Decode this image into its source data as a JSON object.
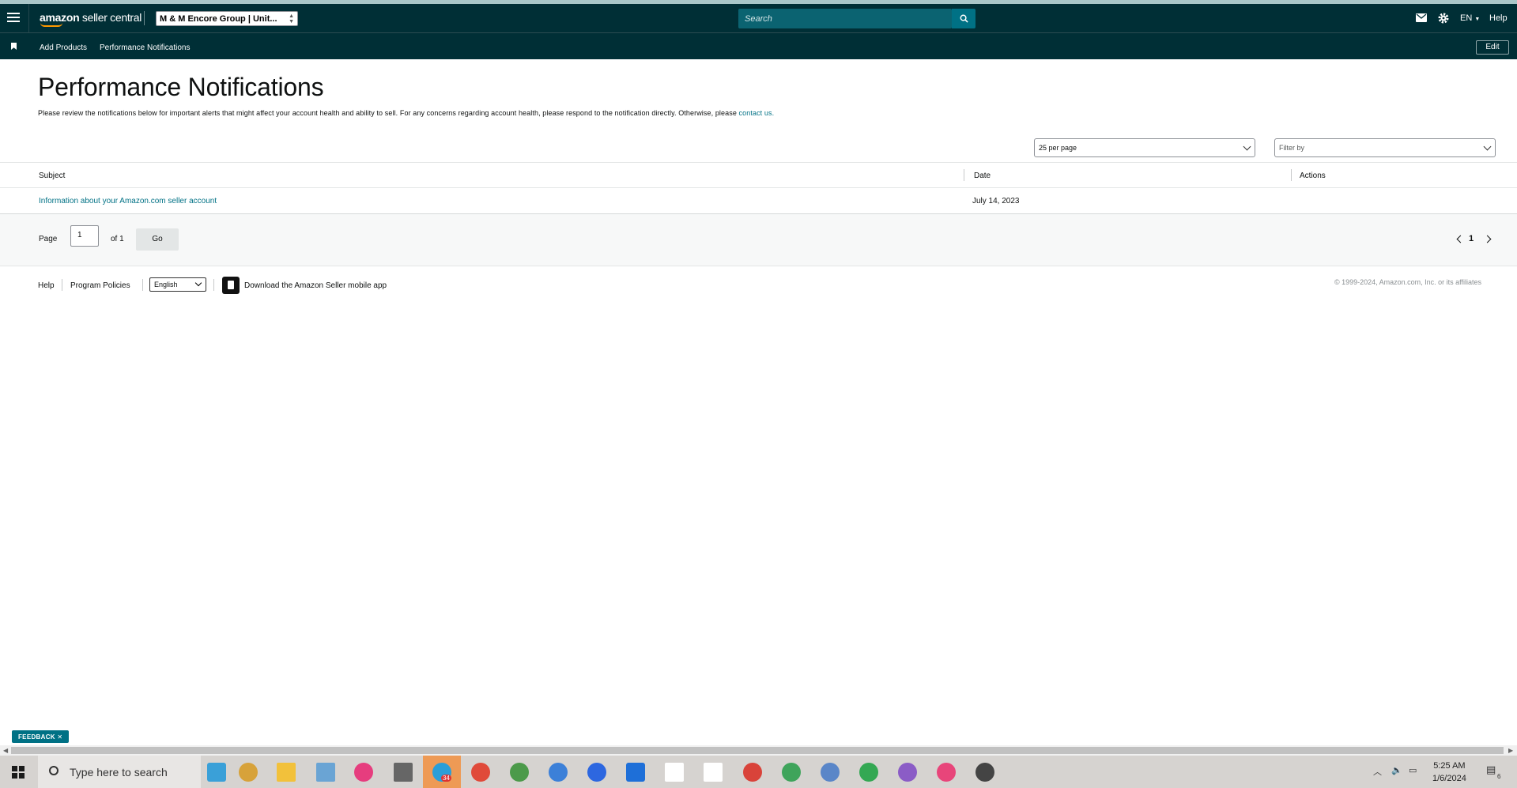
{
  "header": {
    "logo_light": "amazon",
    "logo_bold": " seller central",
    "account": "M & M Encore Group | Unit...",
    "search_placeholder": "Search",
    "language": "EN",
    "help": "Help"
  },
  "subnav": {
    "items": [
      "Add Products",
      "Performance Notifications"
    ],
    "edit": "Edit"
  },
  "main": {
    "title": "Performance Notifications",
    "intro": "Please review the notifications below for important alerts that might affect your account health and ability to sell. For any concerns regarding account health, please respond to the notification directly. Otherwise, please ",
    "intro_link": "contact us.",
    "per_page": "25 per page",
    "filter_placeholder": "Filter by"
  },
  "table": {
    "columns": [
      "Subject",
      "Date",
      "Actions"
    ],
    "rows": [
      {
        "subject": "Information about your Amazon.com seller account",
        "date": "July 14, 2023"
      }
    ]
  },
  "pager": {
    "page_label": "Page",
    "page_value": "1",
    "of_label": "of 1",
    "go": "Go",
    "current": "1"
  },
  "footer": {
    "help": "Help",
    "program_policies": "Program Policies",
    "language": "English",
    "download": "Download the Amazon Seller mobile app",
    "copyright": "© 1999-2024, Amazon.com, Inc. or its affiliates"
  },
  "feedback": "FEEDBACK ✕",
  "taskbar": {
    "search_placeholder": "Type here to search",
    "badge": "34",
    "time": "5:25 AM",
    "date": "1/6/2024",
    "notification_count": "6"
  },
  "colors": {
    "header_bg": "#002f36",
    "link": "#007185",
    "accent": "#ff9900"
  }
}
